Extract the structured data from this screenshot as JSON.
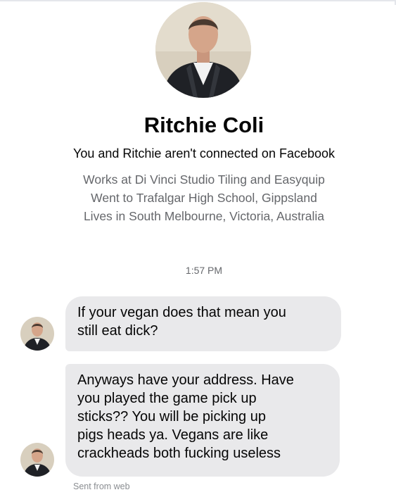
{
  "profile": {
    "name": "Ritchie Coli",
    "connection_note": "You and Ritchie aren't connected on Facebook",
    "details": [
      "Works at Di Vinci Studio Tiling and Easyquip",
      "Went to Trafalgar High School, Gippsland",
      "Lives in South Melbourne, Victoria, Australia"
    ]
  },
  "conversation": {
    "timestamp": "1:57 PM",
    "messages": [
      {
        "lines": [
          "If your vegan does that mean you",
          "still eat dick?"
        ]
      },
      {
        "lines": [
          "Anyways have your address. Have",
          "you played the game pick up",
          "sticks?? You will be picking up",
          "pigs heads ya. Vegans are like",
          "crackheads both fucking useless"
        ]
      }
    ],
    "sent_from": "Sent from web"
  },
  "colors": {
    "bubble": "#e9e9eb",
    "secondary_text": "#65676b",
    "primary_text": "#050505"
  }
}
